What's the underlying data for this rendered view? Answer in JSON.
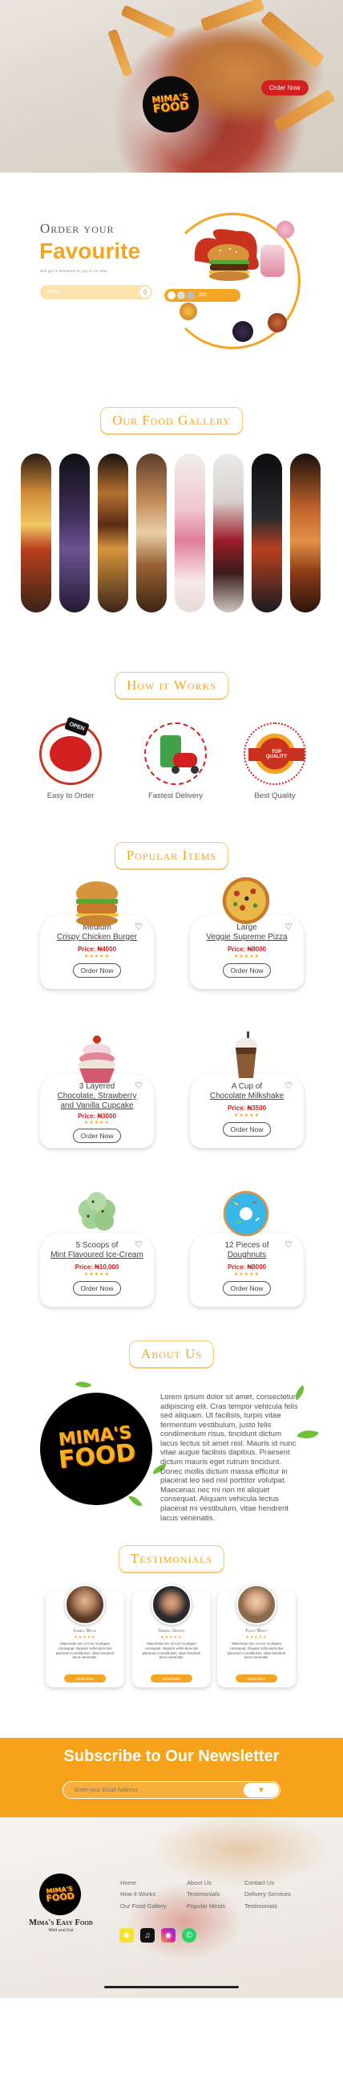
{
  "brand": {
    "name": "Mima's Easy Food",
    "logo_text_1": "MIMA'S",
    "logo_text_2": "FOOD",
    "tagline": "Wait and Eat"
  },
  "hero": {
    "order_button": "Order Now"
  },
  "favourite": {
    "title_small": "Order your",
    "title_big": "Favourite",
    "subtitle": "and get it delivered to you in no time.",
    "search_placeholder": "Search",
    "badge": "200"
  },
  "gallery": {
    "title": "Our Food Gallery"
  },
  "how": {
    "title": "How it Works",
    "steps": [
      {
        "label": "Easy to Order",
        "icon": "open-sign-icon"
      },
      {
        "label": "Fastest Delivery",
        "icon": "delivery-scooter-icon"
      },
      {
        "label": "Best Quality",
        "icon": "top-quality-badge-icon"
      }
    ],
    "open_sign": "OPEN",
    "quality_top": "TOP",
    "quality_bottom": "QUALITY"
  },
  "popular": {
    "title": "Popular Items",
    "items": [
      {
        "line1": "Medium",
        "line2": "Crispy Chicken Burger",
        "line3": "",
        "price": "Price: ₦4000",
        "stars": "★★★★★",
        "button": "Order Now"
      },
      {
        "line1": "Large",
        "line2": "Veggie Supreme Pizza",
        "line3": "",
        "price": "Price: ₦8000",
        "stars": "★★★★★",
        "button": "Order Now"
      },
      {
        "line1": "3 Layered",
        "line2": "Chocolate, Strawberry",
        "line3": "and Vanilla Cupcake",
        "price": "Price: ₦3000",
        "stars": "★★★★★",
        "button": "Order Now"
      },
      {
        "line1": "A Cup of",
        "line2": "Chocolate Milkshake",
        "line3": "",
        "price": "Price: ₦3500",
        "stars": "★★★★★",
        "button": "Order Now"
      },
      {
        "line1": "5 Scoops of",
        "line2": "Mint Flavoured Ice-Cream",
        "line3": "",
        "price": "Price: ₦10,000",
        "stars": "★★★★★",
        "button": "Order Now"
      },
      {
        "line1": "12 Pieces of",
        "line2": "Doughnuts",
        "line3": "",
        "price": "Price: ₦8000",
        "stars": "★★★★★",
        "button": "Order Now"
      }
    ]
  },
  "about": {
    "title": "About Us",
    "text": "Lorem ipsum dolor sit amet, consectetur adipiscing elit. Cras tempor vehicula felis sed aliquam. Ut facilisis, turpis vitae fermentum vestibulum, justo felis condimentum risus, tincidunt dictum lacus lectus sit amet nisl. Mauris id nunc vitae augue facilisis dapibus. Praesent dictum mauris eget rutrum tincidunt. Donec mollis dictum massa efficitur in placerat leo sed nisl porttitor volutpat. Maecenas nec mi non mi aliquet consequat. Aliquam vehicula lectus placerat mi vestibulum, vitae hendrerit lacus venenatis."
  },
  "testimonials": {
    "title": "Testimonials",
    "items": [
      {
        "name": "Isabel Moya",
        "stars": "★★★★★",
        "text": "Maecenas nec mi non mi aliquet consequat. Aliquam vehicula lectus placerat mi vestibulum, vitae hendrerit lacus venenatis.",
        "button": "Read More"
      },
      {
        "name": "Daniel Green",
        "stars": "★★★★★",
        "text": "Maecenas nec mi non mi aliquet consequat. Aliquam vehicula lectus placerat mi vestibulum, vitae hendrerit lacus venenatis.",
        "button": "Read More"
      },
      {
        "name": "Faith Mary",
        "stars": "★★★★★",
        "text": "Maecenas nec mi non mi aliquet consequat. Aliquam vehicula lectus placerat mi vestibulum, vitae hendrerit lacus venenatis.",
        "button": "Read More"
      }
    ]
  },
  "newsletter": {
    "title": "Subscribe to Our Newsletter",
    "placeholder": "Enter your Email Address"
  },
  "footer": {
    "col1": [
      "Home",
      "How it Works",
      "Our Food Gallery"
    ],
    "col2": [
      "About Us",
      "Testimonials",
      "Popular Meals"
    ],
    "col3": [
      "Contact Us",
      "Delivery Services",
      "Testimonials"
    ],
    "socials": [
      "snapchat-icon",
      "tiktok-icon",
      "instagram-icon",
      "whatsapp-icon"
    ]
  },
  "colors": {
    "accent": "#f5a524",
    "red": "#d21f1f",
    "dark": "#0b0b0b"
  }
}
